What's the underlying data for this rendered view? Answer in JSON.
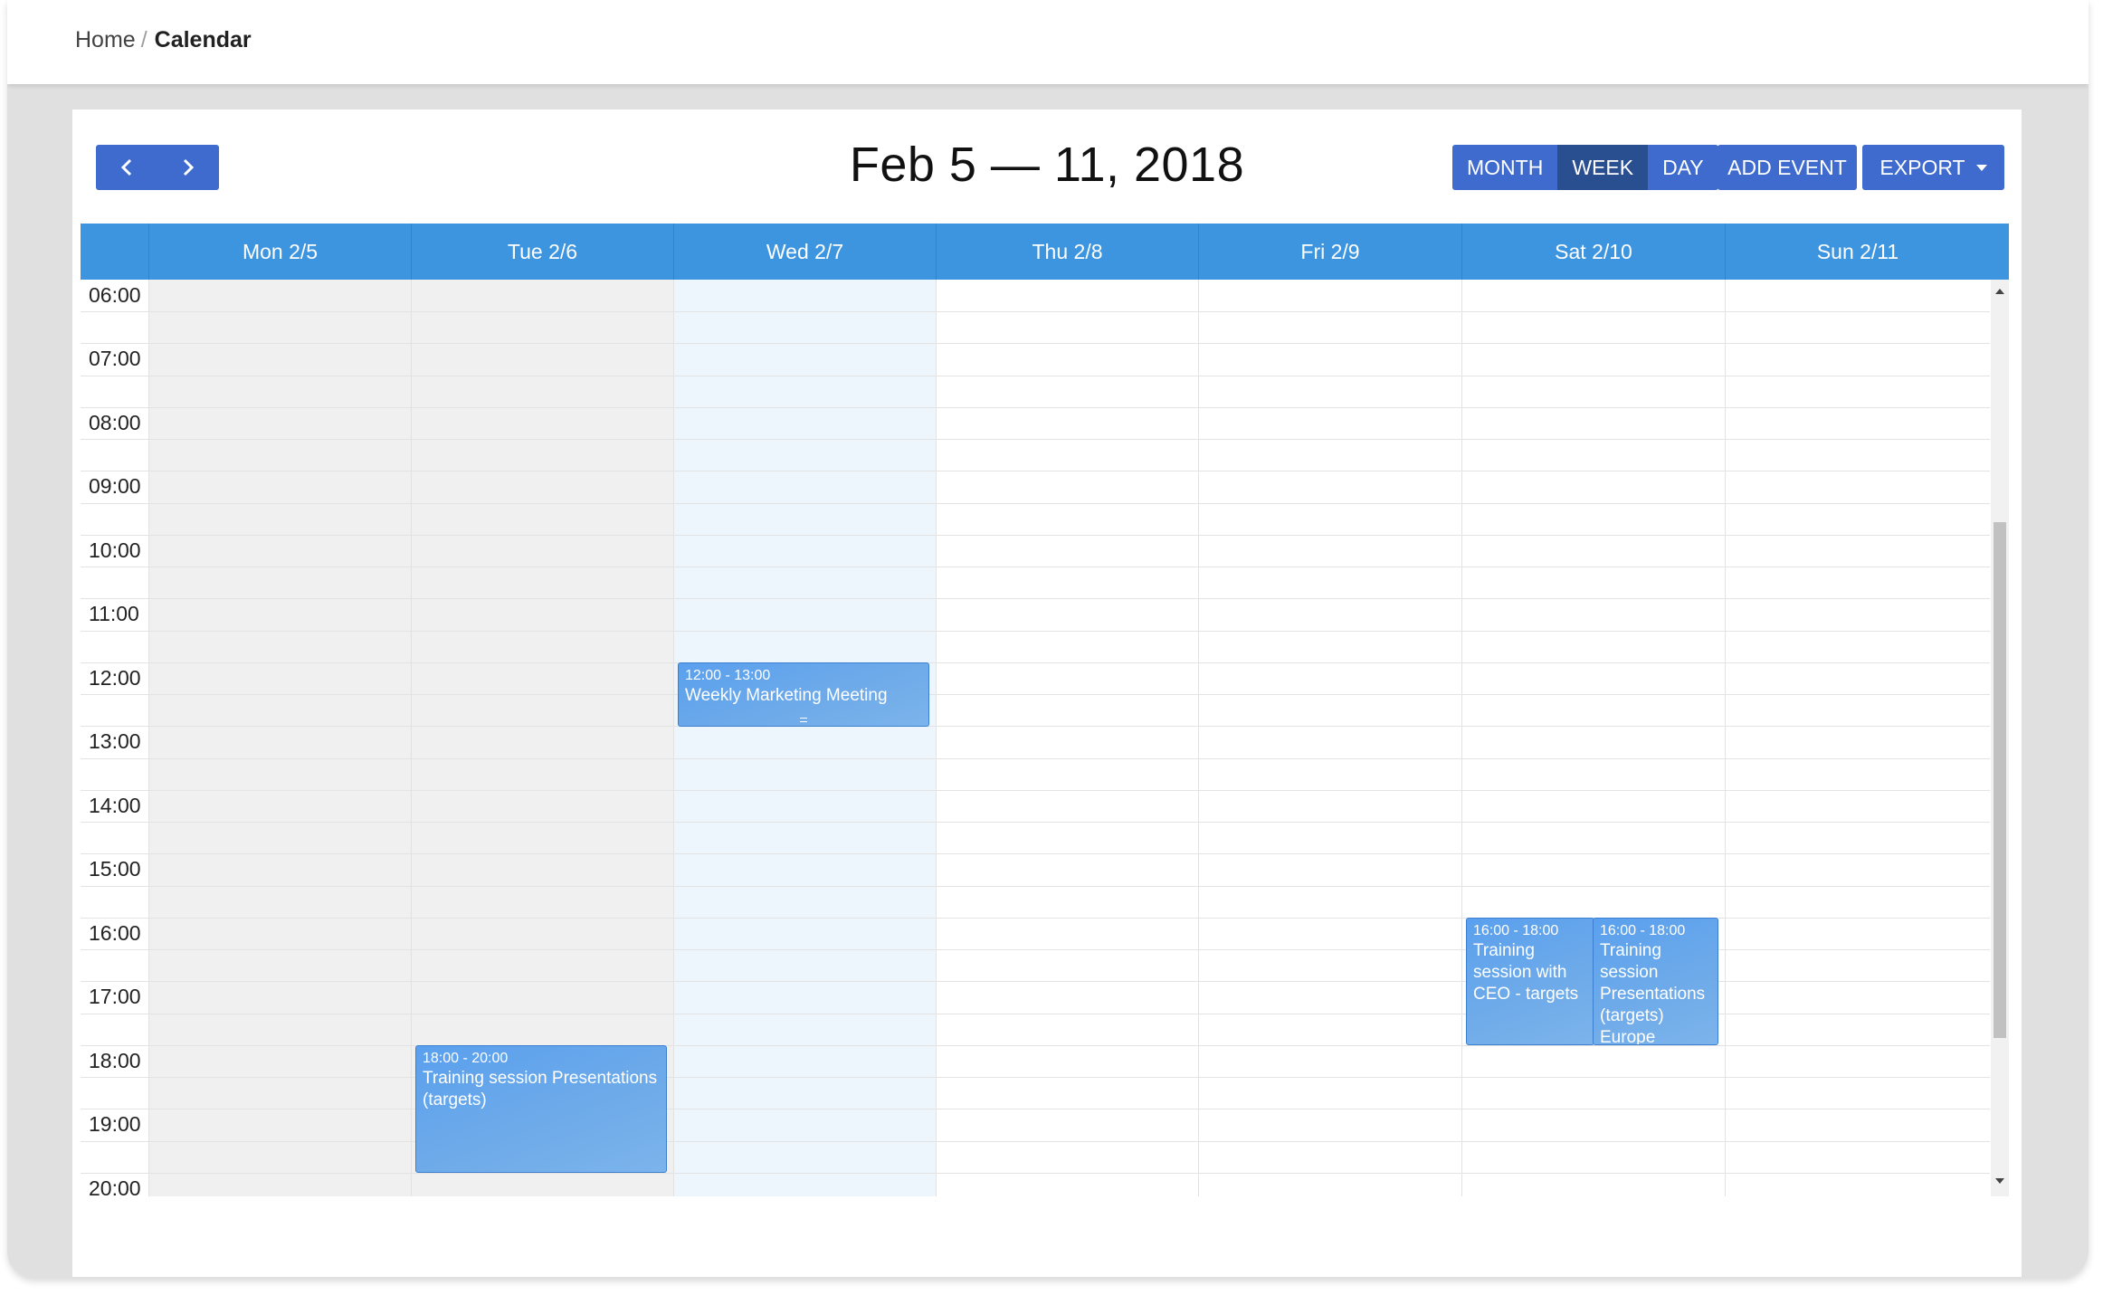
{
  "breadcrumb": {
    "home": "Home",
    "separator": "/",
    "current": "Calendar"
  },
  "toolbar": {
    "title": "Feb 5 — 11, 2018",
    "prev_icon": "chevron-left-icon",
    "next_icon": "chevron-right-icon",
    "prev_label": "‹",
    "next_label": "›",
    "views": [
      {
        "label": "MONTH",
        "active": false
      },
      {
        "label": "WEEK",
        "active": true
      },
      {
        "label": "DAY",
        "active": false
      }
    ],
    "add_event": "ADD EVENT",
    "export": "EXPORT",
    "export_icon": "caret-down-icon"
  },
  "days": [
    "Mon 2/5",
    "Tue 2/6",
    "Wed 2/7",
    "Thu 2/8",
    "Fri 2/9",
    "Sat 2/10",
    "Sun 2/11"
  ],
  "times": [
    "06:00",
    "07:00",
    "08:00",
    "09:00",
    "10:00",
    "11:00",
    "12:00",
    "13:00",
    "14:00",
    "15:00",
    "16:00",
    "17:00",
    "18:00",
    "19:00",
    "20:00"
  ],
  "events": [
    {
      "day": "Wed 2/7",
      "time": "12:00 - 13:00",
      "title": "Weekly Marketing Meeting"
    },
    {
      "day": "Tue 2/6",
      "time": "18:00 - 20:00",
      "title": "Training session Presentations (targets)"
    },
    {
      "day": "Sat 2/10",
      "time": "16:00 - 18:00",
      "title": "Training session with CEO - targets"
    },
    {
      "day": "Sat 2/10",
      "time": "16:00 - 18:00",
      "title": "Training session Presentations (targets) Europe"
    }
  ],
  "colors": {
    "header": "#3d95e0",
    "button": "#3f6bcf",
    "button_active": "#2a4f90",
    "event": "#6aa8ec",
    "past_day": "#f0f0f0",
    "today": "#eef6fd"
  }
}
